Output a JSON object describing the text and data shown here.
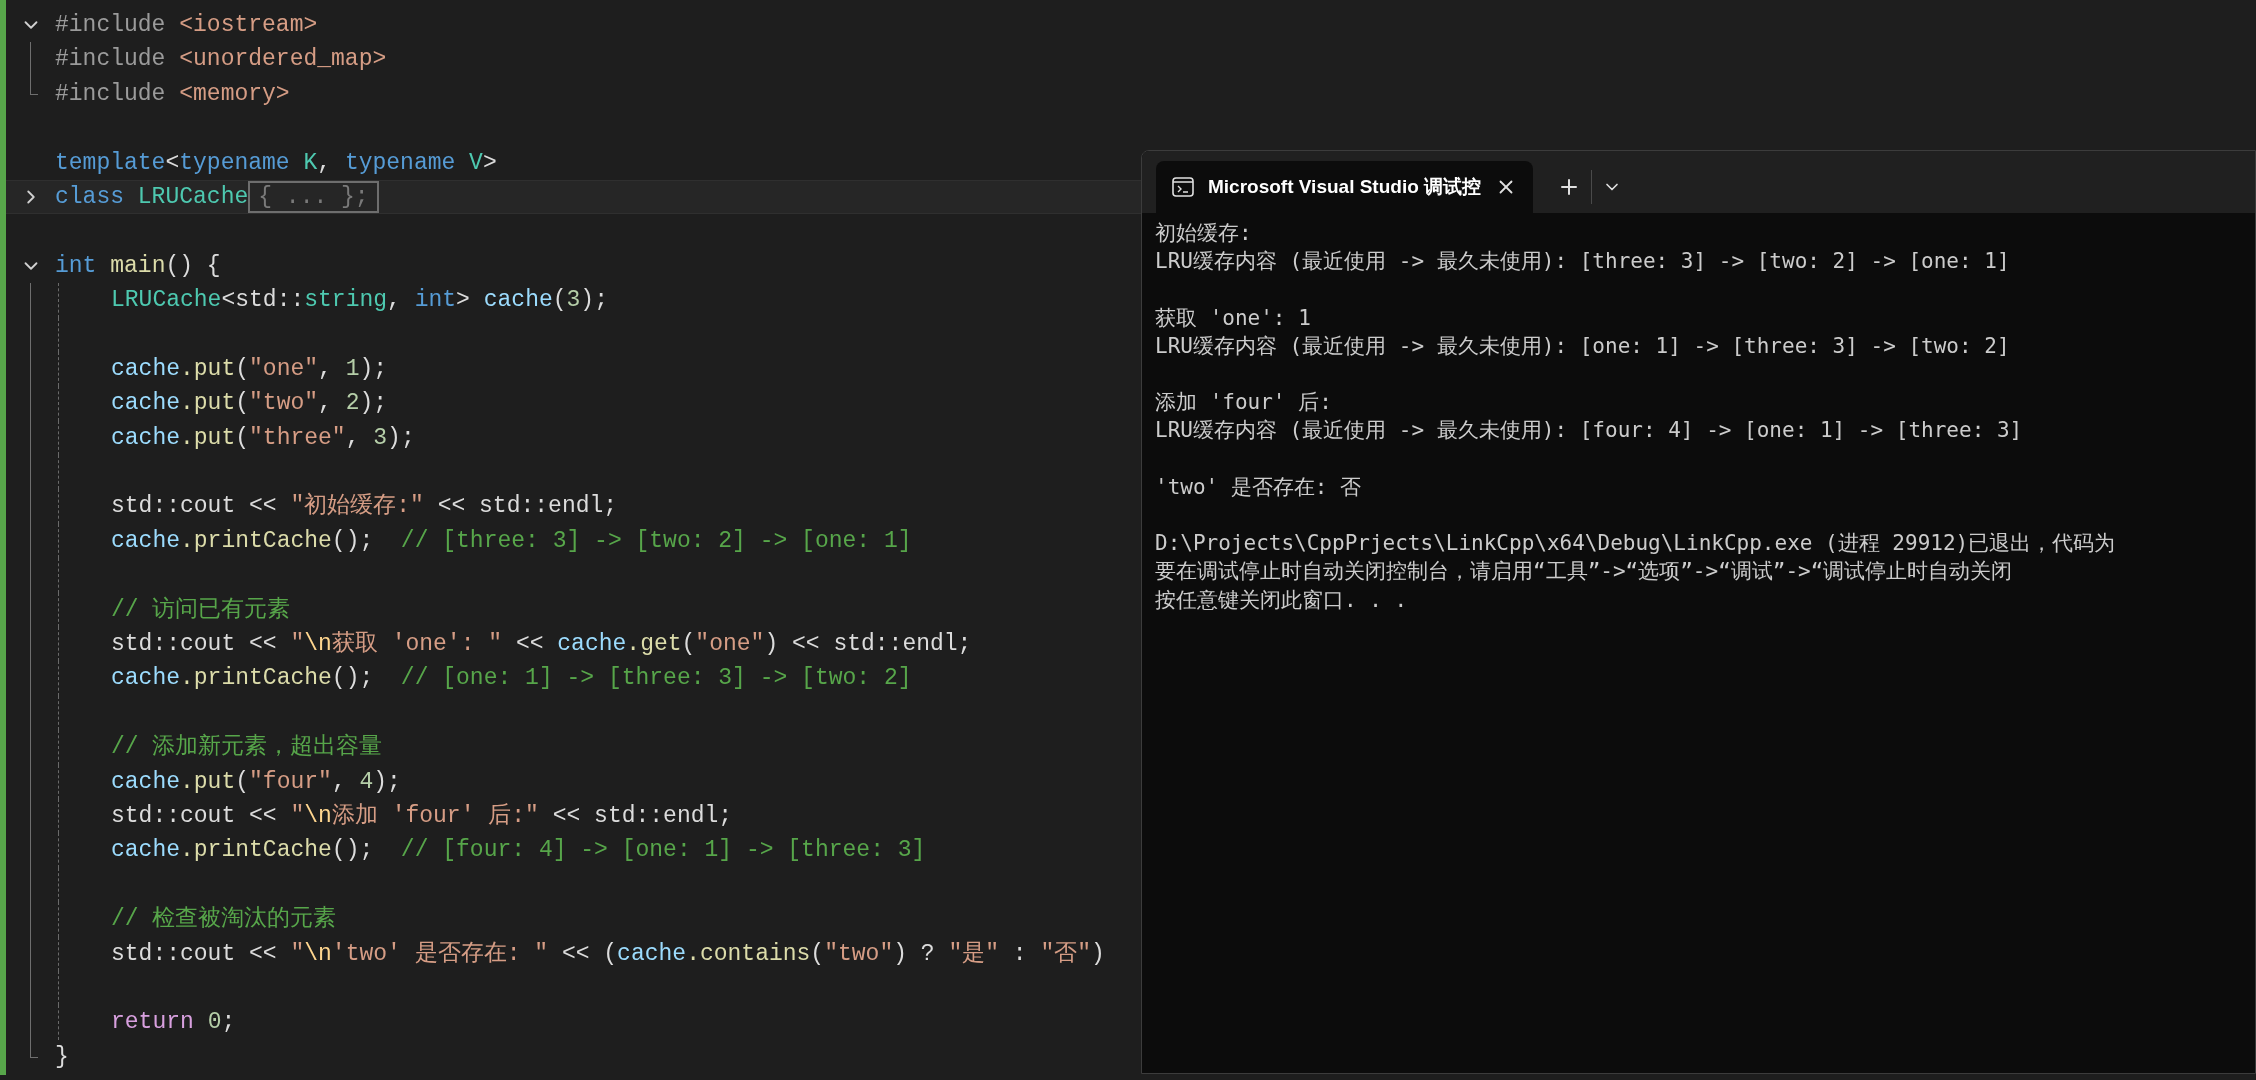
{
  "editor": {
    "lines": [
      {
        "kind": "code",
        "foldable": true,
        "expanded": true,
        "block_end": false,
        "indented": false,
        "current": false,
        "tokens": [
          {
            "text": "#include ",
            "kind": "pp"
          },
          {
            "text": "<iostream>",
            "kind": "inc"
          }
        ]
      },
      {
        "kind": "code",
        "foldable": false,
        "block_end": false,
        "indented": false,
        "current": false,
        "tokens": [
          {
            "text": "#include ",
            "kind": "pp"
          },
          {
            "text": "<unordered_map>",
            "kind": "inc"
          }
        ]
      },
      {
        "kind": "code",
        "foldable": false,
        "block_end": true,
        "indented": false,
        "current": false,
        "tokens": [
          {
            "text": "#include ",
            "kind": "pp"
          },
          {
            "text": "<memory>",
            "kind": "inc"
          }
        ]
      },
      {
        "kind": "blank",
        "foldable": false,
        "block_end": false,
        "indented": false,
        "current": false
      },
      {
        "kind": "code",
        "foldable": false,
        "block_end": false,
        "indented": false,
        "current": false,
        "tokens": [
          {
            "text": "template",
            "kind": "kw"
          },
          {
            "text": "<",
            "kind": "p"
          },
          {
            "text": "typename",
            "kind": "kw"
          },
          {
            "text": " K",
            "kind": "type"
          },
          {
            "text": ", ",
            "kind": "p"
          },
          {
            "text": "typename",
            "kind": "kw"
          },
          {
            "text": " V",
            "kind": "type"
          },
          {
            "text": ">",
            "kind": "p"
          }
        ]
      },
      {
        "kind": "code",
        "foldable": true,
        "expanded": false,
        "block_end": false,
        "indented": false,
        "current": true,
        "tokens": [
          {
            "text": "class",
            "kind": "kw"
          },
          {
            "text": " LRUCache",
            "kind": "type"
          },
          {
            "text": "{ ... };",
            "kind": "collapsed"
          }
        ]
      },
      {
        "kind": "blank",
        "foldable": false,
        "block_end": false,
        "indented": false,
        "current": false
      },
      {
        "kind": "code",
        "foldable": true,
        "expanded": true,
        "block_end": false,
        "indented": false,
        "current": false,
        "tokens": [
          {
            "text": "int",
            "kind": "kw"
          },
          {
            "text": " main",
            "kind": "fn"
          },
          {
            "text": "() {",
            "kind": "p"
          }
        ]
      },
      {
        "kind": "code",
        "foldable": false,
        "block_end": false,
        "indented": true,
        "current": false,
        "tokens": [
          {
            "text": "LRUCache",
            "kind": "type"
          },
          {
            "text": "<std::",
            "kind": "p"
          },
          {
            "text": "string",
            "kind": "type"
          },
          {
            "text": ", ",
            "kind": "p"
          },
          {
            "text": "int",
            "kind": "kw"
          },
          {
            "text": "> ",
            "kind": "p"
          },
          {
            "text": "cache",
            "kind": "var"
          },
          {
            "text": "(",
            "kind": "p"
          },
          {
            "text": "3",
            "kind": "num"
          },
          {
            "text": ");",
            "kind": "p"
          }
        ]
      },
      {
        "kind": "blank",
        "foldable": false,
        "block_end": false,
        "indented": true,
        "current": false
      },
      {
        "kind": "code",
        "foldable": false,
        "block_end": false,
        "indented": true,
        "current": false,
        "tokens": [
          {
            "text": "cache",
            "kind": "var"
          },
          {
            "text": ".put",
            "kind": "fn"
          },
          {
            "text": "(",
            "kind": "p"
          },
          {
            "text": "\"one\"",
            "kind": "str"
          },
          {
            "text": ", ",
            "kind": "p"
          },
          {
            "text": "1",
            "kind": "num"
          },
          {
            "text": ");",
            "kind": "p"
          }
        ]
      },
      {
        "kind": "code",
        "foldable": false,
        "block_end": false,
        "indented": true,
        "current": false,
        "tokens": [
          {
            "text": "cache",
            "kind": "var"
          },
          {
            "text": ".put",
            "kind": "fn"
          },
          {
            "text": "(",
            "kind": "p"
          },
          {
            "text": "\"two\"",
            "kind": "str"
          },
          {
            "text": ", ",
            "kind": "p"
          },
          {
            "text": "2",
            "kind": "num"
          },
          {
            "text": ");",
            "kind": "p"
          }
        ]
      },
      {
        "kind": "code",
        "foldable": false,
        "block_end": false,
        "indented": true,
        "current": false,
        "tokens": [
          {
            "text": "cache",
            "kind": "var"
          },
          {
            "text": ".put",
            "kind": "fn"
          },
          {
            "text": "(",
            "kind": "p"
          },
          {
            "text": "\"three\"",
            "kind": "str"
          },
          {
            "text": ", ",
            "kind": "p"
          },
          {
            "text": "3",
            "kind": "num"
          },
          {
            "text": ");",
            "kind": "p"
          }
        ]
      },
      {
        "kind": "blank",
        "foldable": false,
        "block_end": false,
        "indented": true,
        "current": false
      },
      {
        "kind": "code",
        "foldable": false,
        "block_end": false,
        "indented": true,
        "current": false,
        "tokens": [
          {
            "text": "std::cout << ",
            "kind": "p"
          },
          {
            "text": "\"初始缓存:\"",
            "kind": "str"
          },
          {
            "text": " << std::endl;",
            "kind": "p"
          }
        ]
      },
      {
        "kind": "code",
        "foldable": false,
        "block_end": false,
        "indented": true,
        "current": false,
        "tokens": [
          {
            "text": "cache",
            "kind": "var"
          },
          {
            "text": ".printCache",
            "kind": "fn"
          },
          {
            "text": "();  ",
            "kind": "p"
          },
          {
            "text": "// [three: 3] -> [two: 2] -> [one: 1]",
            "kind": "cmt"
          }
        ]
      },
      {
        "kind": "blank",
        "foldable": false,
        "block_end": false,
        "indented": true,
        "current": false
      },
      {
        "kind": "code",
        "foldable": false,
        "block_end": false,
        "indented": true,
        "current": false,
        "tokens": [
          {
            "text": "// 访问已有元素",
            "kind": "cmt"
          }
        ]
      },
      {
        "kind": "code",
        "foldable": false,
        "block_end": false,
        "indented": true,
        "current": false,
        "tokens": [
          {
            "text": "std::cout << ",
            "kind": "p"
          },
          {
            "text": "\"",
            "kind": "str"
          },
          {
            "text": "\\n",
            "kind": "esc"
          },
          {
            "text": "获取 'one': \"",
            "kind": "str"
          },
          {
            "text": " << ",
            "kind": "p"
          },
          {
            "text": "cache",
            "kind": "var"
          },
          {
            "text": ".get",
            "kind": "fn"
          },
          {
            "text": "(",
            "kind": "p"
          },
          {
            "text": "\"one\"",
            "kind": "str"
          },
          {
            "text": ") << std::endl;",
            "kind": "p"
          }
        ]
      },
      {
        "kind": "code",
        "foldable": false,
        "block_end": false,
        "indented": true,
        "current": false,
        "tokens": [
          {
            "text": "cache",
            "kind": "var"
          },
          {
            "text": ".printCache",
            "kind": "fn"
          },
          {
            "text": "();  ",
            "kind": "p"
          },
          {
            "text": "// [one: 1] -> [three: 3] -> [two: 2]",
            "kind": "cmt"
          }
        ]
      },
      {
        "kind": "blank",
        "foldable": false,
        "block_end": false,
        "indented": true,
        "current": false
      },
      {
        "kind": "code",
        "foldable": false,
        "block_end": false,
        "indented": true,
        "current": false,
        "tokens": [
          {
            "text": "// 添加新元素，超出容量",
            "kind": "cmt"
          }
        ]
      },
      {
        "kind": "code",
        "foldable": false,
        "block_end": false,
        "indented": true,
        "current": false,
        "tokens": [
          {
            "text": "cache",
            "kind": "var"
          },
          {
            "text": ".put",
            "kind": "fn"
          },
          {
            "text": "(",
            "kind": "p"
          },
          {
            "text": "\"four\"",
            "kind": "str"
          },
          {
            "text": ", ",
            "kind": "p"
          },
          {
            "text": "4",
            "kind": "num"
          },
          {
            "text": ");",
            "kind": "p"
          }
        ]
      },
      {
        "kind": "code",
        "foldable": false,
        "block_end": false,
        "indented": true,
        "current": false,
        "tokens": [
          {
            "text": "std::cout << ",
            "kind": "p"
          },
          {
            "text": "\"",
            "kind": "str"
          },
          {
            "text": "\\n",
            "kind": "esc"
          },
          {
            "text": "添加 'four' 后:\"",
            "kind": "str"
          },
          {
            "text": " << std::endl;",
            "kind": "p"
          }
        ]
      },
      {
        "kind": "code",
        "foldable": false,
        "block_end": false,
        "indented": true,
        "current": false,
        "tokens": [
          {
            "text": "cache",
            "kind": "var"
          },
          {
            "text": ".printCache",
            "kind": "fn"
          },
          {
            "text": "();  ",
            "kind": "p"
          },
          {
            "text": "// [four: 4] -> [one: 1] -> [three: 3]",
            "kind": "cmt"
          }
        ]
      },
      {
        "kind": "blank",
        "foldable": false,
        "block_end": false,
        "indented": true,
        "current": false
      },
      {
        "kind": "code",
        "foldable": false,
        "block_end": false,
        "indented": true,
        "current": false,
        "tokens": [
          {
            "text": "// 检查被淘汰的元素",
            "kind": "cmt"
          }
        ]
      },
      {
        "kind": "code",
        "foldable": false,
        "block_end": false,
        "indented": true,
        "current": false,
        "tokens": [
          {
            "text": "std::cout << ",
            "kind": "p"
          },
          {
            "text": "\"",
            "kind": "str"
          },
          {
            "text": "\\n",
            "kind": "esc"
          },
          {
            "text": "'two' 是否存在: \"",
            "kind": "str"
          },
          {
            "text": " << (",
            "kind": "p"
          },
          {
            "text": "cache",
            "kind": "var"
          },
          {
            "text": ".contains",
            "kind": "fn"
          },
          {
            "text": "(",
            "kind": "p"
          },
          {
            "text": "\"two\"",
            "kind": "str"
          },
          {
            "text": ") ? ",
            "kind": "p"
          },
          {
            "text": "\"是\"",
            "kind": "str"
          },
          {
            "text": " : ",
            "kind": "p"
          },
          {
            "text": "\"否\"",
            "kind": "str"
          },
          {
            "text": ")",
            "kind": "p"
          }
        ]
      },
      {
        "kind": "blank",
        "foldable": false,
        "block_end": false,
        "indented": true,
        "current": false
      },
      {
        "kind": "code",
        "foldable": false,
        "block_end": false,
        "indented": true,
        "current": false,
        "tokens": [
          {
            "text": "return",
            "kind": "ctl"
          },
          {
            "text": " 0",
            "kind": "num"
          },
          {
            "text": ";",
            "kind": "p"
          }
        ]
      },
      {
        "kind": "code",
        "foldable": false,
        "block_end": true,
        "indented": false,
        "current": false,
        "tokens": [
          {
            "text": "}",
            "kind": "p"
          }
        ]
      }
    ]
  },
  "terminal": {
    "tabs": [
      {
        "title": "Microsoft Visual Studio 调试控",
        "selected": true
      }
    ],
    "blocks": [
      {
        "lines": [
          "初始缓存:",
          "LRU缓存内容 (最近使用 -> 最久未使用): [three: 3] -> [two: 2] -> [one: 1]"
        ]
      },
      {
        "lines": [
          "获取 'one': 1",
          "LRU缓存内容 (最近使用 -> 最久未使用): [one: 1] -> [three: 3] -> [two: 2]"
        ]
      },
      {
        "lines": [
          "添加 'four' 后:",
          "LRU缓存内容 (最近使用 -> 最久未使用): [four: 4] -> [one: 1] -> [three: 3]"
        ]
      },
      {
        "lines": [
          "'two' 是否存在: 否"
        ]
      },
      {
        "lines": [
          "D:\\Projects\\CppPrjects\\LinkCpp\\x64\\Debug\\LinkCpp.exe (进程 29912)已退出，代码为",
          "要在调试停止时自动关闭控制台，请启用“工具”->“选项”->“调试”->“调试停止时自动关闭",
          "按任意键关闭此窗口. . ."
        ]
      }
    ]
  }
}
